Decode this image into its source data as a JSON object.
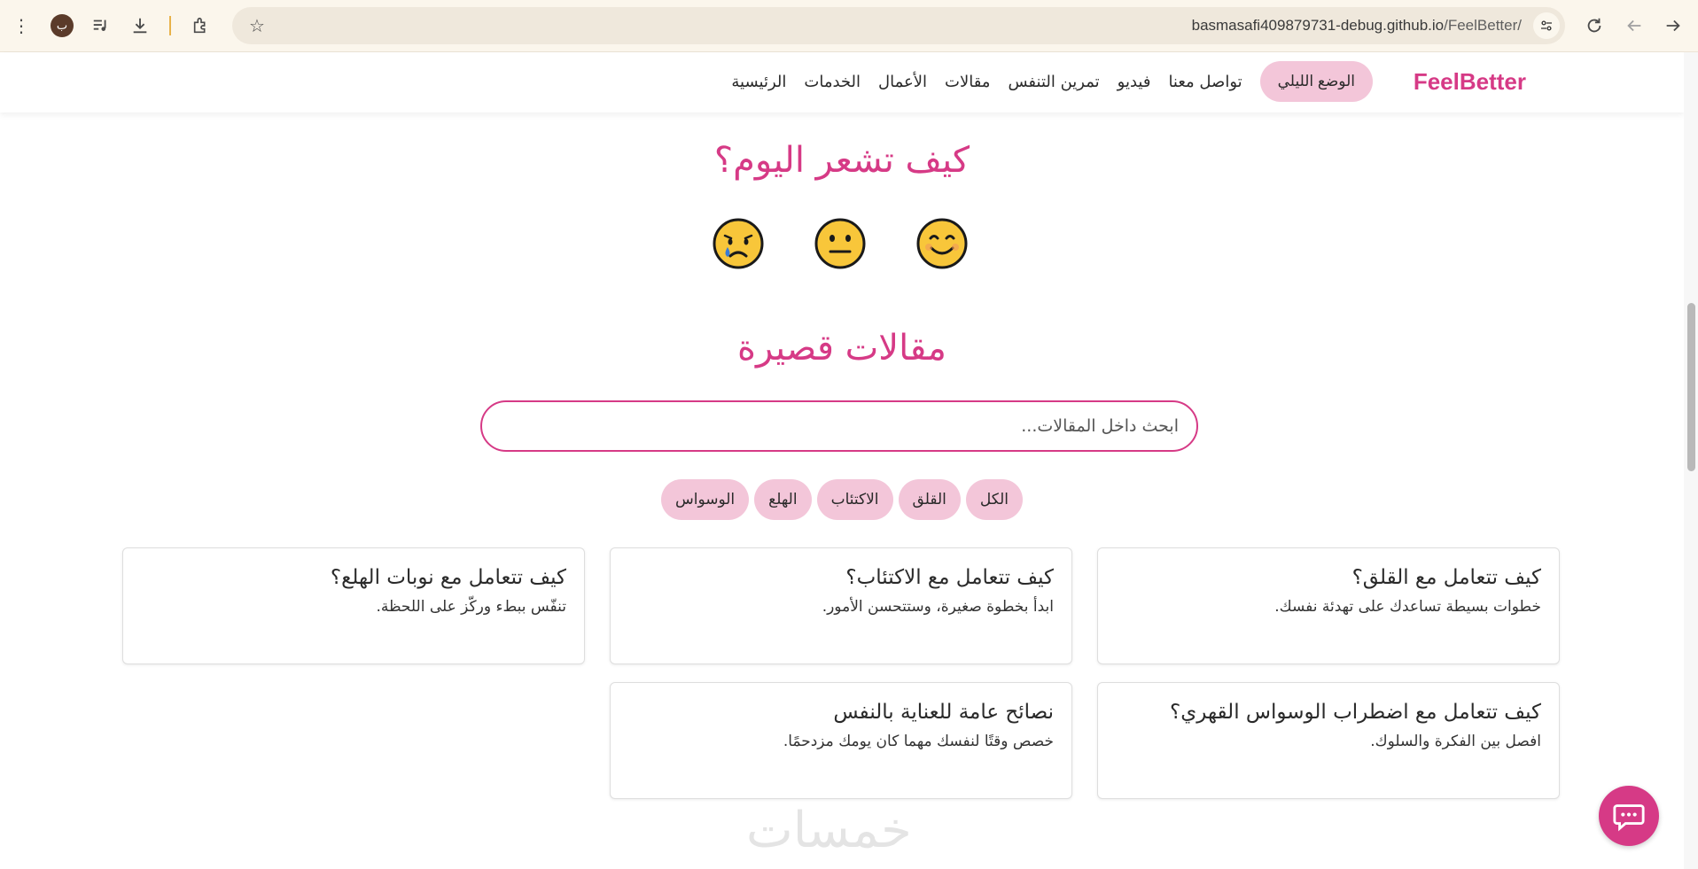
{
  "browser": {
    "url_host": "basmasafi409879731-debug.github.io",
    "url_path": "/FeelBetter/",
    "avatar_letter": "ب"
  },
  "site": {
    "brand": "FeelBetter",
    "nav": [
      "الرئيسية",
      "الخدمات",
      "الأعمال",
      "مقالات",
      "تمرين التنفس",
      "فيديو",
      "تواصل معنا"
    ],
    "night_mode_label": "الوضع الليلي"
  },
  "mood": {
    "title": "كيف تشعر اليوم؟",
    "emojis": [
      "smiling-face-icon",
      "neutral-face-icon",
      "crying-face-icon"
    ]
  },
  "articles": {
    "title": "مقالات قصيرة",
    "search_placeholder": "ابحث داخل المقالات...",
    "filters": [
      "الكل",
      "القلق",
      "الاكتئاب",
      "الهلع",
      "الوسواس"
    ],
    "cards": [
      {
        "title": "كيف تتعامل مع القلق؟",
        "desc": "خطوات بسيطة تساعدك على تهدئة نفسك."
      },
      {
        "title": "كيف تتعامل مع الاكتئاب؟",
        "desc": "ابدأ بخطوة صغيرة، وستتحسن الأمور."
      },
      {
        "title": "كيف تتعامل مع نوبات الهلع؟",
        "desc": "تنفّس ببطء وركّز على اللحظة."
      },
      {
        "title": "كيف تتعامل مع اضطراب الوسواس القهري؟",
        "desc": "افصل بين الفكرة والسلوك."
      },
      {
        "title": "نصائح عامة للعناية بالنفس",
        "desc": "خصص وقتًا لنفسك مهما كان يومك مزدحمًا."
      }
    ]
  },
  "watermark": "خمسات",
  "colors": {
    "accent": "#d63a86",
    "chip_bg": "#f3c6d9",
    "emoji_yellow": "#f8c63a"
  }
}
